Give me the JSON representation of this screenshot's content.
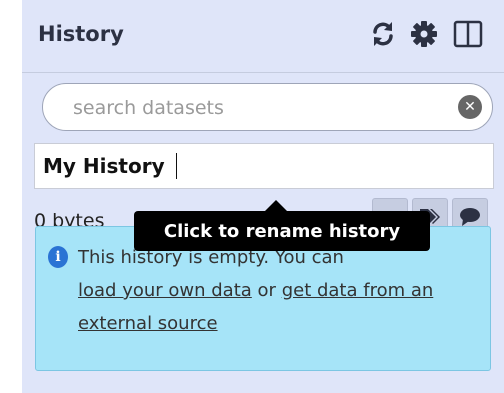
{
  "header": {
    "title": "History",
    "icons": [
      "refresh-icon",
      "gear-icon",
      "columns-icon"
    ]
  },
  "search": {
    "placeholder": "search datasets",
    "value": ""
  },
  "history": {
    "name": "My History",
    "size": "0 bytes"
  },
  "tooltip": {
    "text": "Click to rename history"
  },
  "actions": [
    "tags-icon",
    "annotation-icon"
  ],
  "empty_message": {
    "prefix": "This history is empty. You can",
    "link1": "load your own data",
    "middle": "or",
    "link2": "get data from an external source"
  },
  "colors": {
    "panel_bg": "#dfe5f9",
    "info_bg": "#a6e4f8",
    "info_icon": "#2a73d4"
  }
}
